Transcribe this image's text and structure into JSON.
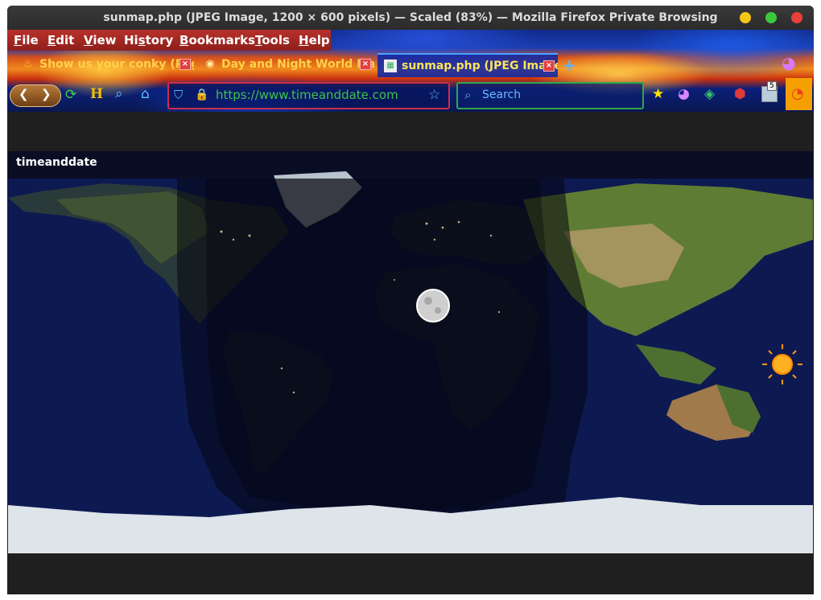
{
  "window": {
    "title": "sunmap.php (JPEG Image, 1200 × 600 pixels) — Scaled (83%) — Mozilla Firefox Private Browsing",
    "controls": [
      "minimize",
      "maximize",
      "close"
    ],
    "control_colors": {
      "minimize": "#f5c518",
      "maximize": "#3cc83c",
      "close": "#e8403a"
    }
  },
  "menubar": {
    "items": [
      {
        "key": "F",
        "rest": "ile"
      },
      {
        "key": "E",
        "rest": "dit"
      },
      {
        "key": "V",
        "rest": "iew"
      },
      {
        "key": "s",
        "pre": "Hi",
        "rest": "tory"
      },
      {
        "key": "B",
        "rest": "ookmarks"
      },
      {
        "key": "T",
        "rest": "ools"
      },
      {
        "key": "H",
        "rest": "elp"
      }
    ]
  },
  "tabs": [
    {
      "label": "Show us your conky (Pag",
      "icon": "flame-icon",
      "active": false
    },
    {
      "label": "Day and Night World Ma",
      "icon": "globe-icon",
      "active": false
    },
    {
      "label": "sunmap.php (JPEG Image",
      "icon": "image-icon",
      "active": true
    }
  ],
  "new_tab_symbol": "+",
  "navbar": {
    "url": "https://www.timeanddate.com/scripts/sunmap.php",
    "url_visible": "https://www.timeanddate.com/scrip",
    "search_placeholder": "Search",
    "badge_count": "5",
    "toolbar_icons": [
      "refresh-icon",
      "history-h-icon",
      "magnifier-icon",
      "home-icon",
      "star-icon",
      "mask-icon",
      "addon-icon",
      "ublock-icon",
      "counter-icon",
      "firefox-icon"
    ]
  },
  "map": {
    "logo_text": "timeanddate",
    "features": [
      "day-night-world-map",
      "moon-marker",
      "sun-marker"
    ],
    "colors": {
      "ocean": "#0c1640",
      "night_overlay": "#05060f",
      "land_day": "#5f7c34",
      "land_night": "#1e2640",
      "ice": "#dde4ea"
    }
  }
}
